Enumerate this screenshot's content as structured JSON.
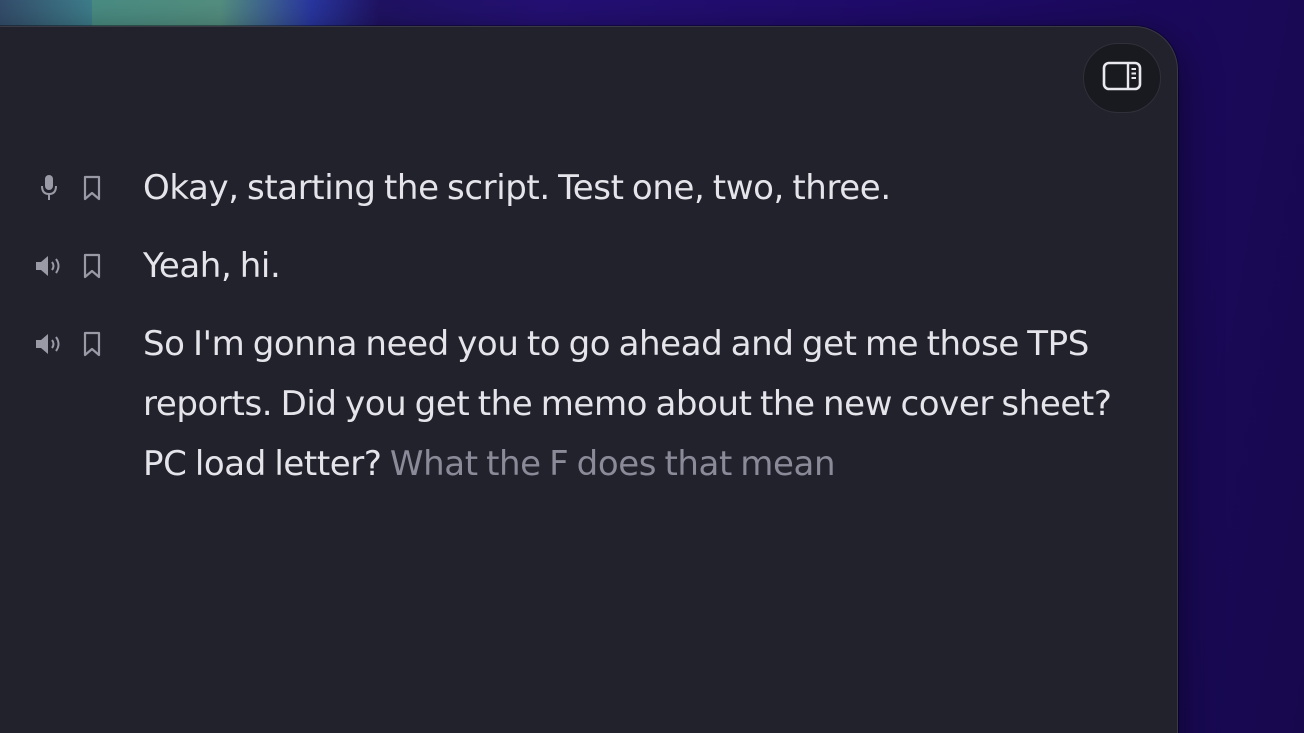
{
  "sidebar_toggle": {
    "icon": "sidebar-right-icon"
  },
  "transcript": [
    {
      "source": "microphone",
      "source_icon": "microphone-icon",
      "bookmark_icon": "bookmark-icon",
      "text": "Okay, starting the script. Test one, two, three.",
      "pending_text": ""
    },
    {
      "source": "system-audio",
      "source_icon": "speaker-icon",
      "bookmark_icon": "bookmark-icon",
      "text": "Yeah, hi.",
      "pending_text": ""
    },
    {
      "source": "system-audio",
      "source_icon": "speaker-icon",
      "bookmark_icon": "bookmark-icon",
      "text": "So I'm gonna need you to go ahead and get me those TPS reports. Did you get the memo about the new cover sheet? PC load letter?",
      "pending_text": "What the F does that mean"
    }
  ],
  "colors": {
    "window_bg": "#22222d",
    "text_final": "#e4e4ea",
    "text_pending": "#8a8a98",
    "icon": "#9a9aa6"
  }
}
